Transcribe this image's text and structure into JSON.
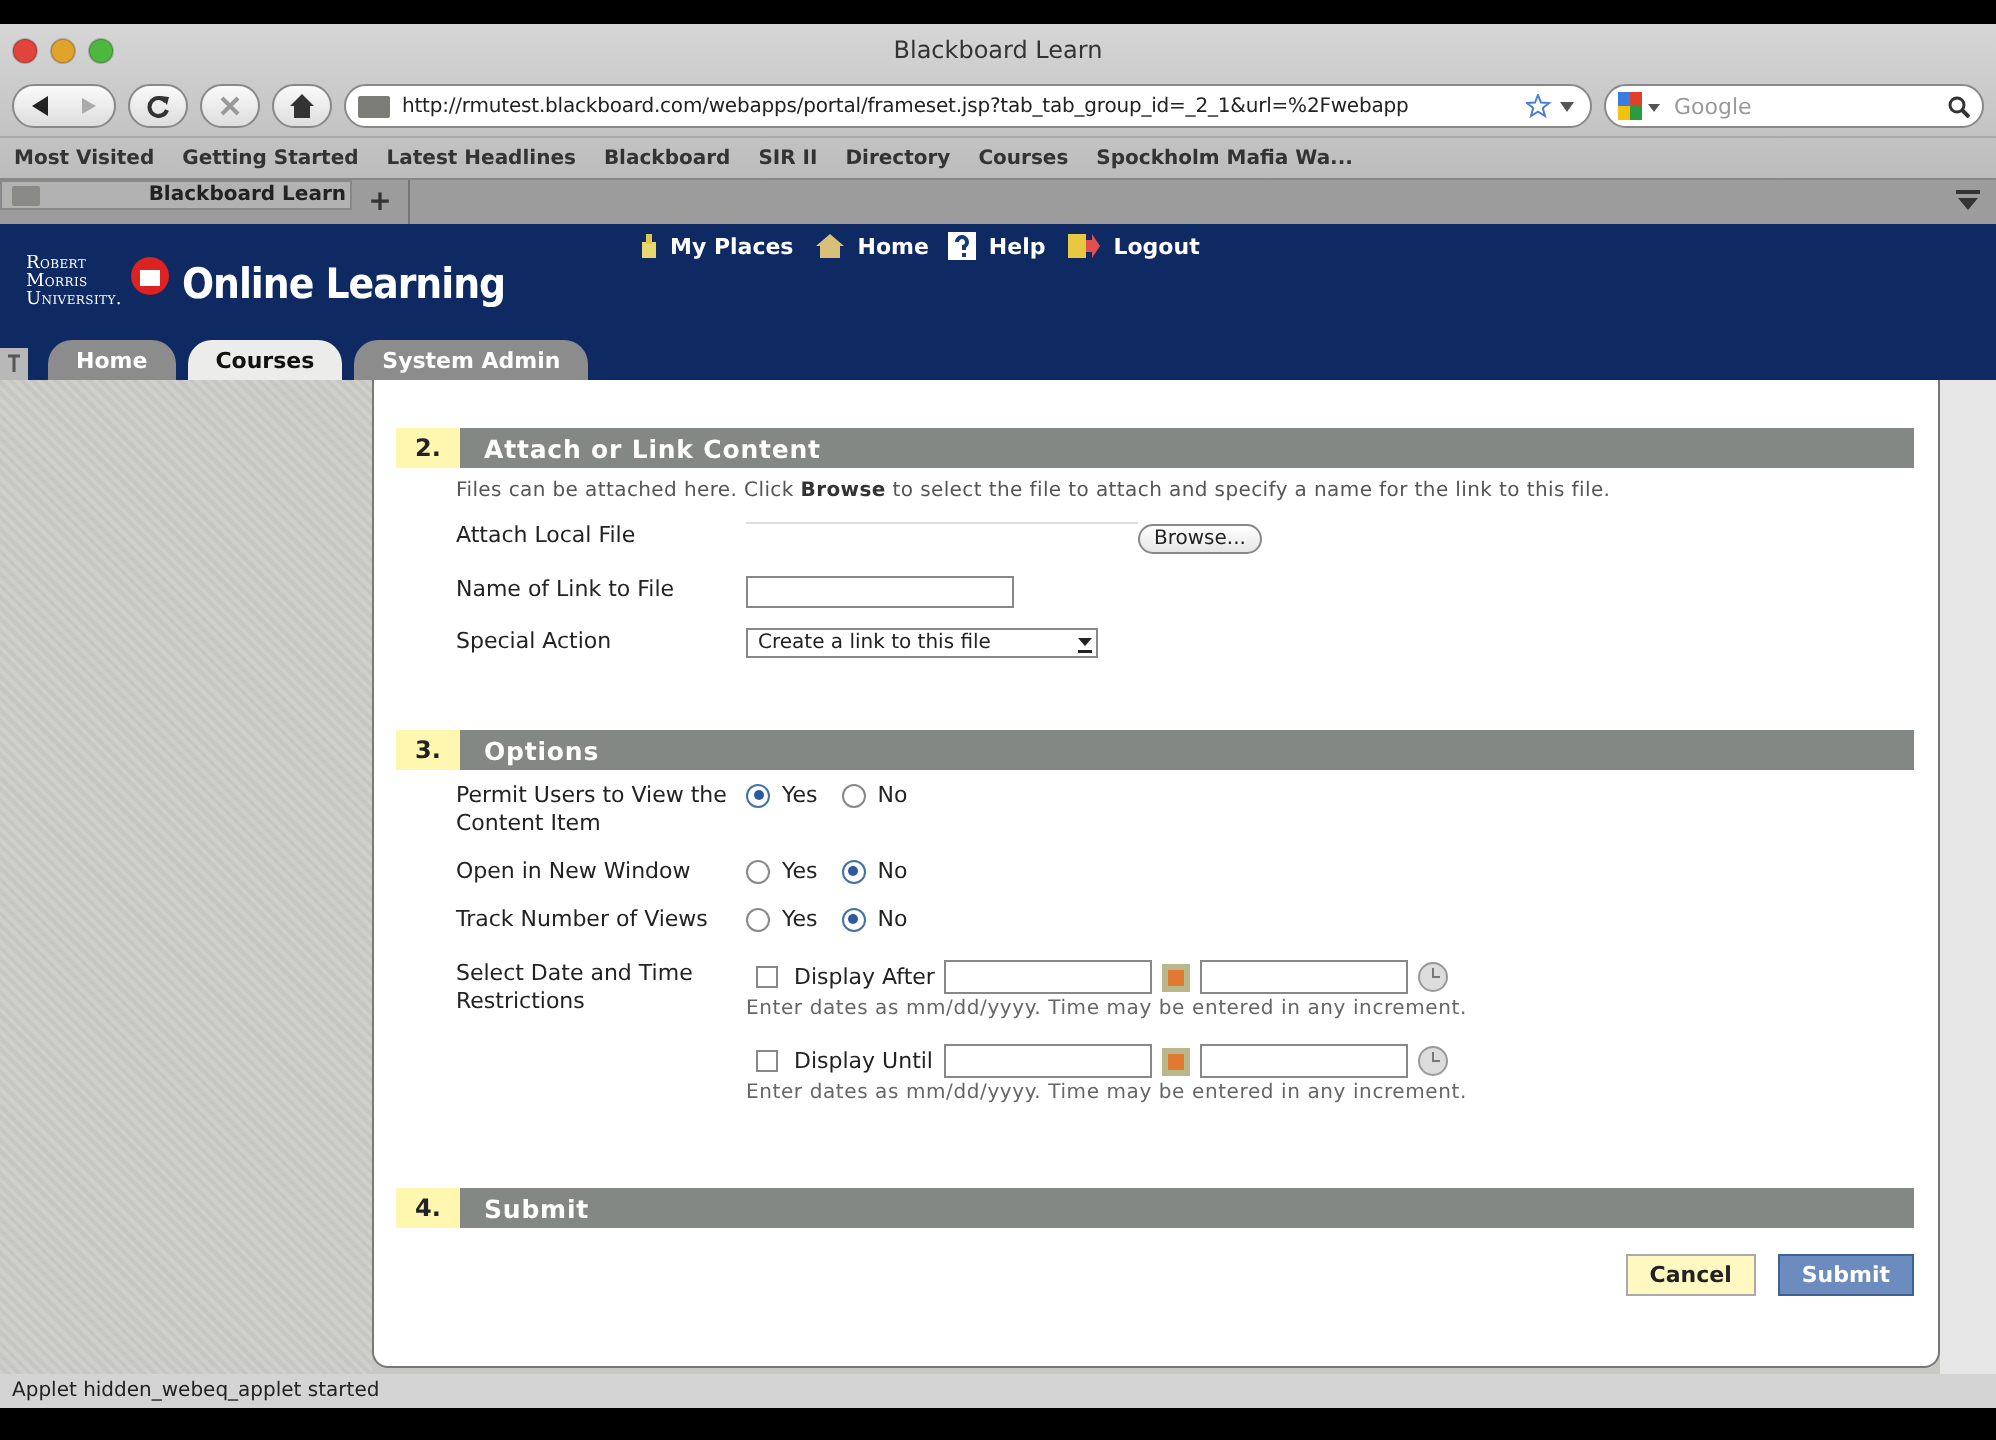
{
  "window": {
    "title": "Blackboard Learn"
  },
  "toolbar": {
    "url": "http://rmutest.blackboard.com/webapps/portal/frameset.jsp?tab_tab_group_id=_2_1&url=%2Fwebapp",
    "search": {
      "placeholder": "Google"
    }
  },
  "bookmarks": [
    "Most Visited",
    "Getting Started",
    "Latest Headlines",
    "Blackboard",
    "SIR II",
    "Directory",
    "Courses",
    "Spockholm Mafia Wa..."
  ],
  "browser_tabs": [
    {
      "label": "Blackboard Learn",
      "selected": true
    }
  ],
  "new_tab": "+",
  "header": {
    "logo_lines": [
      "Robert",
      "Morris",
      "University."
    ],
    "title": "Online Learning",
    "links": [
      "My Places",
      "Home",
      "Help",
      "Logout"
    ]
  },
  "nav_tabs": [
    {
      "label": "Home",
      "selected": false
    },
    {
      "label": "Courses",
      "selected": true
    },
    {
      "label": "System Admin",
      "selected": false
    }
  ],
  "sections": [
    {
      "number": "2.",
      "title": "Attach or Link Content",
      "instructions": "Files can be attached here. Click **Browse** to select the file to attach and specify a name for the link to this file.",
      "rows": [
        {
          "kind": "file",
          "label": "Attach Local File",
          "button": "Browse..."
        },
        {
          "kind": "text",
          "label": "Name of Link to File"
        },
        {
          "kind": "select",
          "label": "Special Action",
          "value": "Create a link to this file"
        }
      ]
    },
    {
      "number": "3.",
      "title": "Options",
      "rows": [
        {
          "kind": "radio",
          "label": "Permit Users to View the Content Item",
          "choices": [
            {
              "label": "Yes",
              "selected": true
            },
            {
              "label": "No",
              "selected": false
            }
          ]
        },
        {
          "kind": "radio",
          "label": "Open in New Window",
          "choices": [
            {
              "label": "Yes",
              "selected": false
            },
            {
              "label": "No",
              "selected": true
            }
          ]
        },
        {
          "kind": "radio",
          "label": "Track Number of Views",
          "choices": [
            {
              "label": "Yes",
              "selected": false
            },
            {
              "label": "No",
              "selected": true
            }
          ]
        },
        {
          "kind": "dates",
          "label": "Select Date and Time Restrictions",
          "entries": [
            {
              "label": "Display After",
              "checked": false,
              "hint": "Enter dates as mm/dd/yyyy. Time may be entered in any increment."
            },
            {
              "label": "Display Until",
              "checked": false,
              "hint": "Enter dates as mm/dd/yyyy. Time may be entered in any increment."
            }
          ]
        }
      ]
    },
    {
      "number": "4.",
      "title": "Submit"
    }
  ],
  "buttons": [
    {
      "label": "Cancel",
      "kind": "cancel"
    },
    {
      "label": "Submit",
      "kind": "submit"
    }
  ],
  "status_bar": "Applet hidden_webeq_applet started"
}
